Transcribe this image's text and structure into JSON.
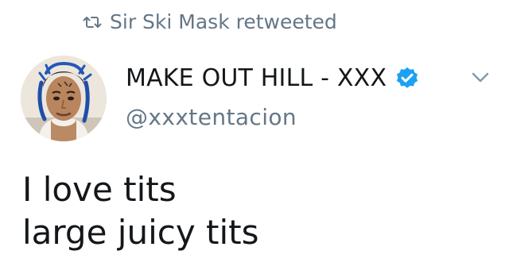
{
  "retweet": {
    "icon": "retweet-icon",
    "label": "Sir Ski Mask retweeted"
  },
  "author": {
    "display_name": "MAKE OUT HILL - XXX",
    "handle": "@xxxtentacion",
    "verified_icon": "verified-badge-icon",
    "avatar": "avatar"
  },
  "menu": {
    "icon": "chevron-down-icon"
  },
  "tweet": {
    "lines": [
      "I love tits",
      "large juicy tits"
    ]
  },
  "colors": {
    "text": "#14171a",
    "muted": "#657786",
    "verified": "#1da1f2"
  }
}
